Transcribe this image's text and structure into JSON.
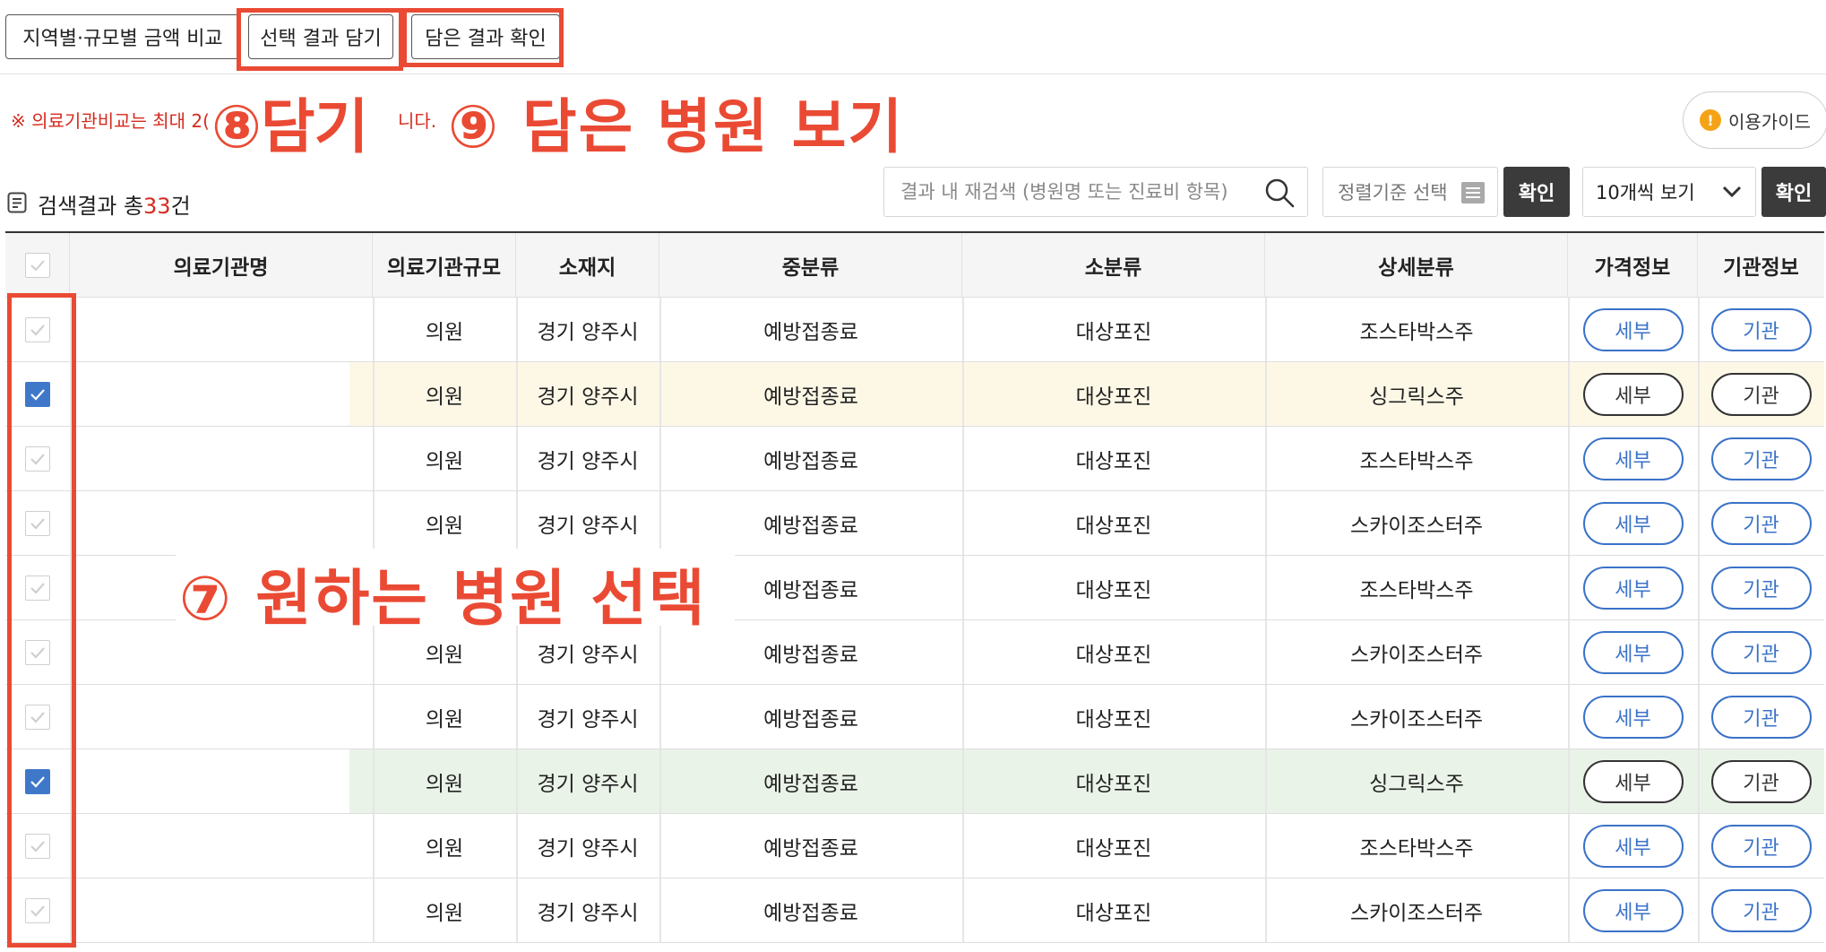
{
  "toolbar": {
    "compare_label": "지역별·규모별 금액 비교",
    "save_selection_label": "선택 결과 담기",
    "view_saved_label": "담은 결과 확인"
  },
  "notice": {
    "start": "※ 의료기관비교는 최대 2(",
    "end": "니다."
  },
  "annotations": {
    "save": "⑧담기",
    "view_saved": "⑨ 담은 병원 보기",
    "select": "⑦ 원하는 병원 선택"
  },
  "guide_label": "이용가이드",
  "results": {
    "prefix": "검색결과 총",
    "count": "33",
    "suffix": "건"
  },
  "search": {
    "placeholder": "결과 내 재검색 (병원명 또는 진료비 항목)"
  },
  "sort": {
    "placeholder": "정렬기준 선택"
  },
  "confirm_label": "확인",
  "per_page": {
    "value": "10개씩 보기"
  },
  "table": {
    "headers": [
      "의료기관명",
      "의료기관규모",
      "소재지",
      "중분류",
      "소분류",
      "상세분류",
      "가격정보",
      "기관정보"
    ],
    "detail_label": "세부",
    "institution_label": "기관",
    "rows": [
      {
        "checked": false,
        "scale": "의원",
        "location": "경기 양주시",
        "middle": "예방접종료",
        "small": "대상포진",
        "detail": "조스타박스주"
      },
      {
        "checked": true,
        "scale": "의원",
        "location": "경기 양주시",
        "middle": "예방접종료",
        "small": "대상포진",
        "detail": "싱그릭스주"
      },
      {
        "checked": false,
        "scale": "의원",
        "location": "경기 양주시",
        "middle": "예방접종료",
        "small": "대상포진",
        "detail": "조스타박스주"
      },
      {
        "checked": false,
        "scale": "의원",
        "location": "경기 양주시",
        "middle": "예방접종료",
        "small": "대상포진",
        "detail": "스카이조스터주"
      },
      {
        "checked": false,
        "scale": "",
        "location": "",
        "middle": "예방접종료",
        "small": "대상포진",
        "detail": "조스타박스주"
      },
      {
        "checked": false,
        "scale": "의원",
        "location": "경기 양주시",
        "middle": "예방접종료",
        "small": "대상포진",
        "detail": "스카이조스터주"
      },
      {
        "checked": false,
        "scale": "의원",
        "location": "경기 양주시",
        "middle": "예방접종료",
        "small": "대상포진",
        "detail": "스카이조스터주"
      },
      {
        "checked": true,
        "scale": "의원",
        "location": "경기 양주시",
        "middle": "예방접종료",
        "small": "대상포진",
        "detail": "싱그릭스주"
      },
      {
        "checked": false,
        "scale": "의원",
        "location": "경기 양주시",
        "middle": "예방접종료",
        "small": "대상포진",
        "detail": "조스타박스주"
      },
      {
        "checked": false,
        "scale": "의원",
        "location": "경기 양주시",
        "middle": "예방접종료",
        "small": "대상포진",
        "detail": "스카이조스터주"
      }
    ]
  },
  "colors": {
    "accent": "#3a72c8",
    "annotation_red": "#ea4a34",
    "notice_red": "#d52b1e",
    "row_highlight_yellow": "#fdf8e6",
    "row_highlight_green": "#eaf3e8"
  }
}
